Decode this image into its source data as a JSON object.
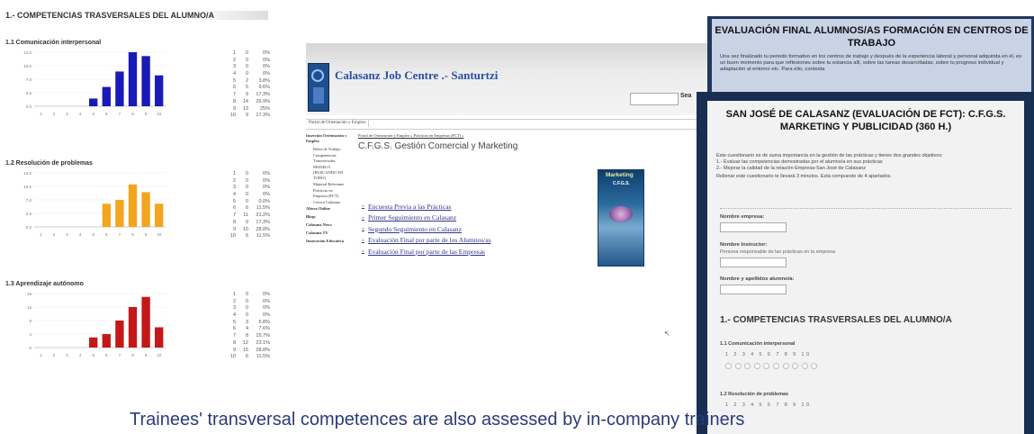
{
  "left_page": {
    "title": "1.- COMPETENCIAS TRASVERSALES DEL ALUMNO/A",
    "sections": [
      {
        "title": "1.1 Comunicación interpersonal"
      },
      {
        "title": "1.2 Resolución de problemas"
      },
      {
        "title": "1.3 Aprendizaje autónomo"
      }
    ]
  },
  "chart_data": [
    {
      "type": "bar",
      "title": "1.1 Comunicación interpersonal",
      "categories": [
        "1",
        "2",
        "3",
        "4",
        "5",
        "6",
        "7",
        "8",
        "9",
        "10"
      ],
      "values": [
        0,
        0,
        0,
        0,
        2,
        5,
        9,
        14,
        13,
        8
      ],
      "color": "#1a1ab8",
      "yticks": [
        "14.0",
        "10.5",
        "7.0",
        "3.5",
        "0.0"
      ],
      "ylim": [
        0,
        14
      ],
      "table": [
        [
          "1",
          "0",
          "0%"
        ],
        [
          "2",
          "0",
          "0%"
        ],
        [
          "3",
          "0",
          "0%"
        ],
        [
          "4",
          "0",
          "0%"
        ],
        [
          "5",
          "2",
          "3.8%"
        ],
        [
          "6",
          "5",
          "9.6%"
        ],
        [
          "7",
          "9",
          "17.3%"
        ],
        [
          "8",
          "14",
          "26.9%"
        ],
        [
          "9",
          "13",
          "25%"
        ],
        [
          "10",
          "9",
          "17.3%"
        ]
      ]
    },
    {
      "type": "bar",
      "title": "1.2 Resolución de problemas",
      "categories": [
        "1",
        "2",
        "3",
        "4",
        "5",
        "6",
        "7",
        "8",
        "9",
        "10"
      ],
      "values": [
        0,
        0,
        0,
        0,
        0,
        6,
        7,
        11,
        9,
        6
      ],
      "color": "#f2a51d",
      "yticks": [
        "14.0",
        "10.5",
        "7.0",
        "3.5",
        "0.0"
      ],
      "ylim": [
        0,
        14
      ],
      "table": [
        [
          "1",
          "0",
          "0%"
        ],
        [
          "2",
          "0",
          "0%"
        ],
        [
          "3",
          "0",
          "0%"
        ],
        [
          "4",
          "0",
          "0%"
        ],
        [
          "5",
          "0",
          "0.0%"
        ],
        [
          "6",
          "6",
          "11.5%"
        ],
        [
          "7",
          "11",
          "21.2%"
        ],
        [
          "8",
          "9",
          "17.3%"
        ],
        [
          "9",
          "10",
          "28.8%"
        ],
        [
          "10",
          "6",
          "11.5%"
        ]
      ]
    },
    {
      "type": "bar",
      "title": "1.3 Aprendizaje autónomo",
      "categories": [
        "1",
        "2",
        "3",
        "4",
        "5",
        "6",
        "7",
        "8",
        "9",
        "10"
      ],
      "values": [
        0,
        0,
        0,
        0,
        3,
        4,
        8,
        12,
        15,
        6
      ],
      "color": "#c41818",
      "yticks": [
        "16",
        "12",
        "8",
        "4",
        "0"
      ],
      "ylim": [
        0,
        16
      ],
      "table": [
        [
          "1",
          "0",
          "0%"
        ],
        [
          "2",
          "0",
          "0%"
        ],
        [
          "3",
          "0",
          "0%"
        ],
        [
          "4",
          "0",
          "0%"
        ],
        [
          "5",
          "3",
          "5.8%"
        ],
        [
          "6",
          "4",
          "7.6%"
        ],
        [
          "7",
          "8",
          "15.7%"
        ],
        [
          "8",
          "12",
          "23.1%"
        ],
        [
          "9",
          "15",
          "28.8%"
        ],
        [
          "10",
          "6",
          "11.5%"
        ]
      ]
    }
  ],
  "site": {
    "title": "Calasanz Job Centre .- Santurtzi",
    "search_button": "Sea",
    "breadcrumb_tab": "Portal de Orientación y Empleo",
    "sidebar": [
      {
        "label": "Inserción Orientación y Empleo",
        "style": "b"
      },
      {
        "label": "Bolsa de Trabajo",
        "style": "sub"
      },
      {
        "label": "Competencias Transversales",
        "style": "sub"
      },
      {
        "label": "MODELO (BUSCANDO EN TODO)",
        "style": "sub"
      },
      {
        "label": "Material Relevante",
        "style": "sub"
      },
      {
        "label": "Prácticas en Empresa (FCT)",
        "style": "sub"
      },
      {
        "label": "Coloca Calasanz",
        "style": "sub"
      },
      {
        "label": "Altura Online",
        "style": "b"
      },
      {
        "label": "Blogs",
        "style": "b"
      },
      {
        "label": "Calasanz News",
        "style": "b"
      },
      {
        "label": "Calasanz TV",
        "style": "b"
      },
      {
        "label": "Innovación Educativa",
        "style": "b"
      }
    ],
    "path": "Portal de Orientación y Empleo » Prácticas en Empresas (FCT) »",
    "heading": "C.F.G.S. Gestión Comercial y Marketing",
    "links": [
      "Encuesta Previa a las Prácticas",
      "Primer Seguimiento en Calasanz",
      "Segundo Seguimiento en Calasanz",
      "Evaluación Final por parte de los Alumnos/as",
      "Evaluación Final por parte de las Empresas"
    ],
    "book_title": "Marketing",
    "book_subtitle": "C.F.G.S."
  },
  "panel_a": {
    "title": "EVALUACIÓN FINAL ALUMNOS/AS FORMACIÓN EN CENTROS DE TRABAJO",
    "text": "Una vez finalizado tu periodo formativo en los centros de trabajo y después de la experiencia laboral y personal adquirida en él, es un buen momento para que reflexiones sobre tu estancia allí, sobre las tareas desarrolladas, sobre tu progreso individual y adaptación al entorno etc. Para ello, contesta"
  },
  "panel_b": {
    "title": "SAN JOSÉ DE CALASANZ (EVALUACIÓN DE FCT): C.F.G.S. MARKETING Y PUBLICIDAD (360 H.)",
    "desc_lines": [
      "Este cuestionario es de suma importancia en la gestión de las prácticas y tienes dos grandes objetivos:",
      "1.- Evaluar las competencias demostradas por el alumno/a en sus prácticas",
      "2.- Mejorar la calidad de la relación Empresa-San José de Calasanz",
      "Rellenar este cuestionario te llevará 3 minutos. Está compuesto de 4 apartados"
    ],
    "fields": [
      {
        "label": "Nombre empresa:",
        "hint": ""
      },
      {
        "label": "Nombre Instructor:",
        "hint": "Persona responsable de las prácticas en la empresa"
      },
      {
        "label": "Nombre y apellidos alumno/a:",
        "hint": ""
      }
    ],
    "section_title": "1.- COMPETENCIAS TRASVERSALES DEL ALUMNO/A",
    "questions": [
      {
        "title": "1.1 Comunicación interpersonal",
        "scale": "1 2 3 4 5 6 7 8 9 10"
      },
      {
        "title": "1.2 Resolución de problemas",
        "scale": "1 2 3 4 5 6 7 8 9 10"
      }
    ]
  },
  "caption": "Trainees' transversal competences are also assessed by in-company trainers"
}
